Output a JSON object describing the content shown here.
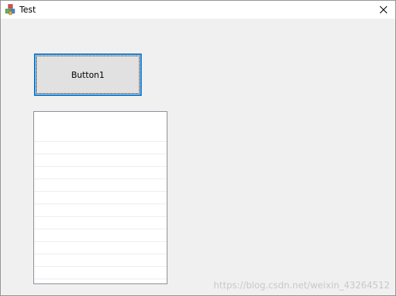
{
  "window": {
    "title": "Test",
    "close_label": "Close"
  },
  "icons": {
    "app": "app-cubes-icon",
    "close": "close-icon"
  },
  "form": {
    "button1_label": "Button1",
    "listbox_items": []
  },
  "watermark": "https://blog.csdn.net/weixin_43264512",
  "colors": {
    "focus_border": "#0078d7",
    "button_face": "#e1e1e1",
    "window_bg": "#f0f0f0"
  }
}
